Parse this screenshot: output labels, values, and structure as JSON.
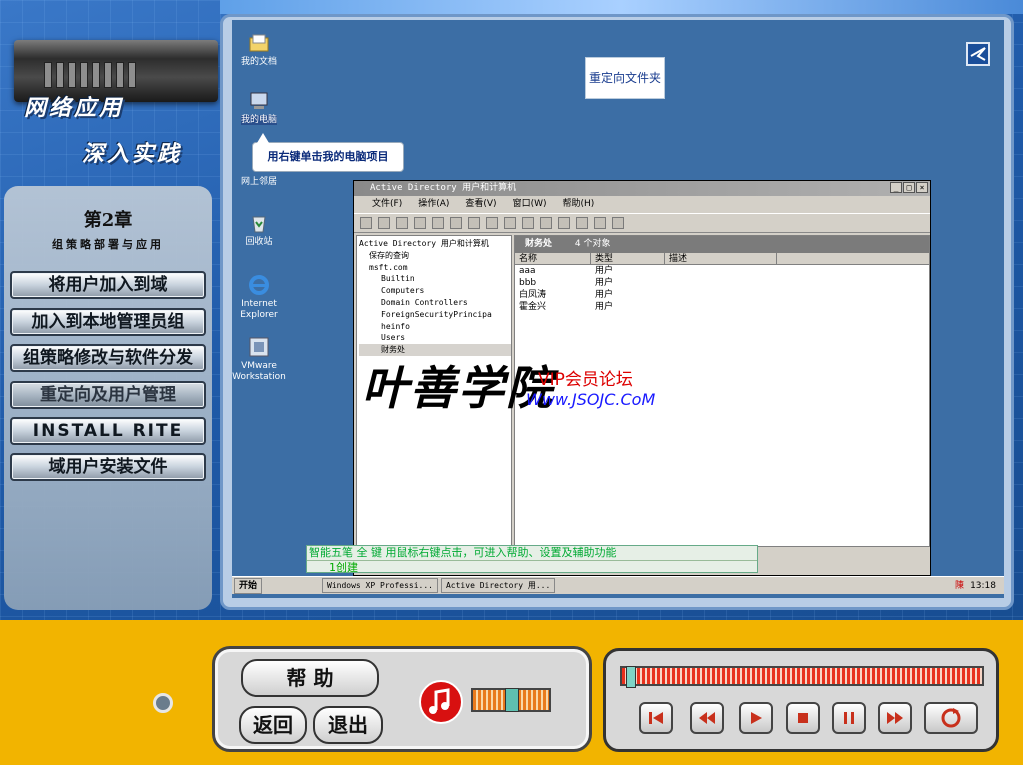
{
  "logo": {
    "line1": "网络应用",
    "line2": "深入实践"
  },
  "chapter": {
    "title": "第2章",
    "subtitle": "组策略部署与应用"
  },
  "menu": [
    {
      "label": "将用户加入到域"
    },
    {
      "label": "加入到本地管理员组"
    },
    {
      "label": "组策略修改与软件分发"
    },
    {
      "label": "重定向及用户管理"
    },
    {
      "label": "INSTALL RITE"
    },
    {
      "label": "域用户安装文件"
    }
  ],
  "desktop": {
    "icons": [
      {
        "label": "我的文档",
        "icon": "my-documents-icon"
      },
      {
        "label": "我的电脑",
        "icon": "my-computer-icon"
      },
      {
        "label": "网上邻居",
        "icon": "network-places-icon"
      },
      {
        "label": "回收站",
        "icon": "recycle-bin-icon"
      },
      {
        "label": "Internet Explorer",
        "icon": "internet-explorer-icon"
      },
      {
        "label": "VMware Workstation",
        "icon": "vmware-icon"
      }
    ],
    "note_box": "重定向文件夹",
    "callout": "用右键单击我的电脑项目"
  },
  "window": {
    "title": "Active Directory 用户和计算机",
    "menu": [
      "文件(F)",
      "操作(A)",
      "查看(V)",
      "窗口(W)",
      "帮助(H)"
    ],
    "tree": [
      "Active Directory 用户和计算机",
      "保存的查询",
      "msft.com",
      "Builtin",
      "Computers",
      "Domain Controllers",
      "ForeignSecurityPrincipa",
      "heinfo",
      "Users",
      "财务处"
    ],
    "panel_title": "财务处",
    "panel_count": "4 个对象",
    "columns": [
      "名称",
      "类型",
      "描述"
    ],
    "rows": [
      {
        "name": "aaa",
        "type": "用户"
      },
      {
        "name": "bbb",
        "type": "用户"
      },
      {
        "name": "白凤涛",
        "type": "用户"
      },
      {
        "name": "霍金兴",
        "type": "用户"
      }
    ]
  },
  "ime": {
    "mode": "智能五笔",
    "full": "全",
    "key": "键",
    "hint": "用鼠标右键点击，可进入帮助、设置及辅助功能",
    "candidate": "1创建"
  },
  "taskbar": {
    "start": "开始",
    "tasks": [
      "Windows XP Professi...",
      "Active Directory 用..."
    ],
    "ime_indicator": "陳",
    "time": "13:18"
  },
  "watermark": {
    "brand": "叶善学院",
    "vip": "VIP会员论坛",
    "url": "Www.JSOJC.CoM"
  },
  "controls": {
    "help": "帮 助",
    "back": "返回",
    "exit": "退出",
    "progress": 0.01
  },
  "colors": {
    "accent": "#f2b400",
    "desktop": "#3c6ea5",
    "progress": "#e8301c"
  }
}
